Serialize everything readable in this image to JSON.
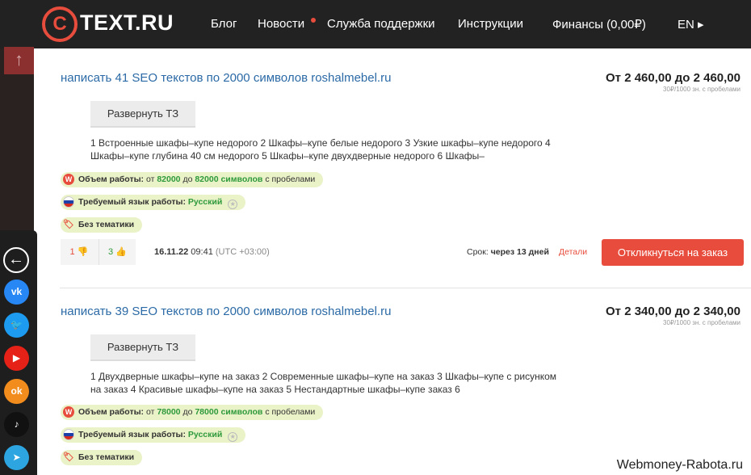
{
  "header": {
    "logo_symbol": "C",
    "logo_text": "TEXT.RU",
    "nav": [
      "Блог",
      "Новости",
      "Служба поддержки",
      "Инструкции",
      "Финансы (0,00₽)",
      "EN ▸"
    ]
  },
  "scroll_up": "↑",
  "social": {
    "back": "←",
    "items": [
      {
        "name": "vk",
        "label": "vk",
        "color": "#2787f5"
      },
      {
        "name": "twitter",
        "label": "🐦",
        "color": "#1d9bf0"
      },
      {
        "name": "youtube",
        "label": "▶",
        "color": "#e62117"
      },
      {
        "name": "odnoklassniki",
        "label": "ok",
        "color": "#f28c1d"
      },
      {
        "name": "tiktok",
        "label": "♪",
        "color": "#111111"
      },
      {
        "name": "telegram",
        "label": "➤",
        "color": "#2ca5e0"
      }
    ]
  },
  "orders": [
    {
      "title": "написать 41 SEO текстов по 2000 символов roshalmebel.ru",
      "price": "От 2 460,00 до 2 460,00",
      "price_note": "30₽/1000 зн. с пробелами",
      "expand_label": "Развернуть ТЗ",
      "description": "1 Встроенные шкафы–купе недорого 2 Шкафы–купе белые недорого 3 Узкие шкафы–купе недорого 4 Шкафы–купе глубина 40 см недорого 5 Шкафы–купе двухдверные недорого 6 Шкафы–",
      "volume": {
        "label": "Объем работы:",
        "from": "от",
        "min": "82000",
        "to": "до",
        "max": "82000 символов",
        "suffix": "с пробелами"
      },
      "language": {
        "label": "Требуемый язык работы:",
        "value": "Русский"
      },
      "topic": "Без тематики",
      "votes_down": "1",
      "votes_up": "3",
      "date": "16.11.22",
      "time": "09:41",
      "tz": "(UTC +03:00)",
      "deadline_label": "Срок:",
      "deadline_value": "через 13 дней",
      "details": "Детали",
      "respond": "Откликнуться на заказ"
    },
    {
      "title": "написать 39 SEO текстов по 2000 символов roshalmebel.ru",
      "price": "От 2 340,00 до 2 340,00",
      "price_note": "30₽/1000 зн. с пробелами",
      "expand_label": "Развернуть ТЗ",
      "description": "1 Двухдверные шкафы–купе на заказ 2 Современные шкафы–купе на заказ 3 Шкафы–купе с рисунком на заказ 4 Красивые шкафы–купе на заказ 5 Нестандартные шкафы–купе заказ 6",
      "volume": {
        "label": "Объем работы:",
        "from": "от",
        "min": "78000",
        "to": "до",
        "max": "78000 символов",
        "suffix": "с пробелами"
      },
      "language": {
        "label": "Требуемый язык работы:",
        "value": "Русский"
      },
      "topic": "Без тематики"
    }
  ],
  "watermark": "Webmoney-Rabota.ru"
}
